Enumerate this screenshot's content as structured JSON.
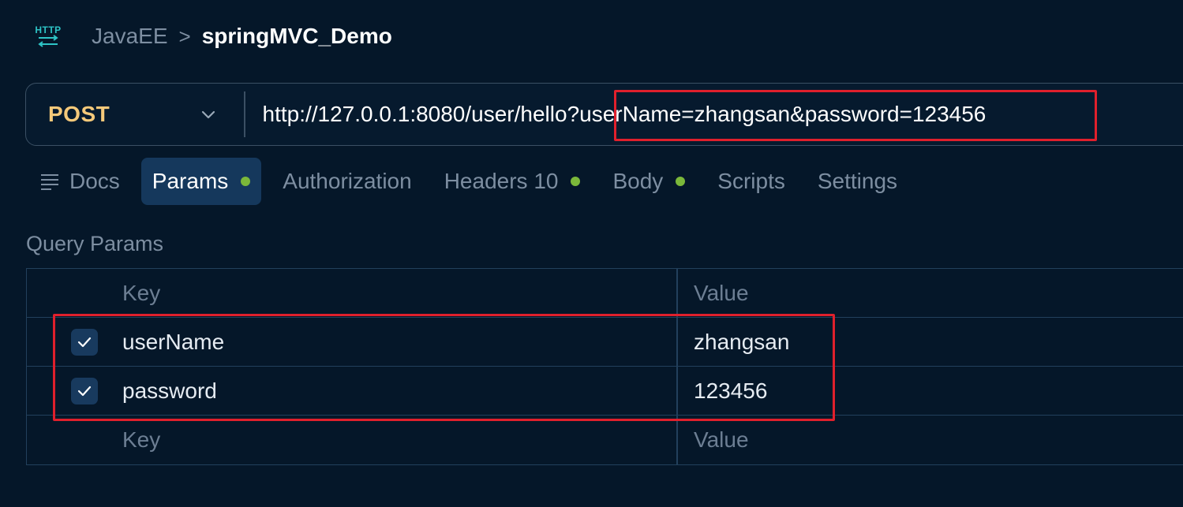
{
  "breadcrumb": {
    "icon_text": "HTTP",
    "parent": "JavaEE",
    "separator": ">",
    "current": "springMVC_Demo"
  },
  "request": {
    "method": "POST",
    "url": "http://127.0.0.1:8080/user/hello?userName=zhangsan&password=123456"
  },
  "tabs": [
    {
      "label": "Docs"
    },
    {
      "label": "Params",
      "active": true,
      "has_dot": true
    },
    {
      "label": "Authorization"
    },
    {
      "label": "Headers 10",
      "has_dot": true
    },
    {
      "label": "Body",
      "has_dot": true
    },
    {
      "label": "Scripts"
    },
    {
      "label": "Settings"
    }
  ],
  "query_params": {
    "title": "Query Params",
    "headers": {
      "key": "Key",
      "value": "Value"
    },
    "rows": [
      {
        "key": "userName",
        "value": "zhangsan",
        "checked": true
      },
      {
        "key": "password",
        "value": "123456",
        "checked": true
      }
    ],
    "empty_row": {
      "key_placeholder": "Key",
      "value_placeholder": "Value"
    }
  },
  "colors": {
    "background": "#051729",
    "method": "#f5c97a",
    "active_tab": "#15385c",
    "indicator_dot": "#7bb83a",
    "annotation": "#e0202c"
  }
}
